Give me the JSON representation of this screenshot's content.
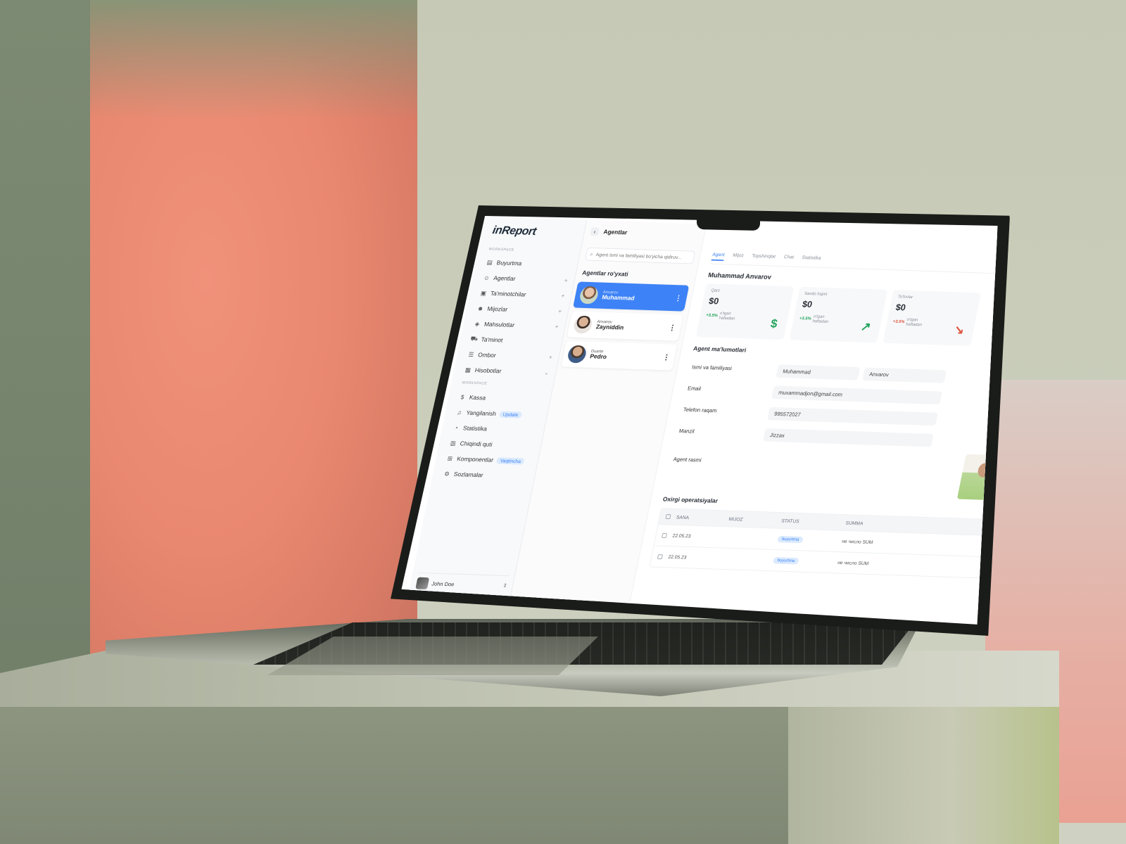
{
  "brand": {
    "logo": "inReport",
    "accent": "#3d82f6"
  },
  "sidebar": {
    "section_labels": [
      "WORKSPACE",
      "WORKSPACE"
    ],
    "items": [
      {
        "label": "Buyurtma",
        "icon": "clipboard-icon",
        "plus": false
      },
      {
        "label": "Agentlar",
        "icon": "users-icon",
        "plus": true
      },
      {
        "label": "Ta'minotchilar",
        "icon": "supplier-icon",
        "plus": true
      },
      {
        "label": "Mijozlar",
        "icon": "user-plus-icon",
        "plus": true
      },
      {
        "label": "Mahsulotlar",
        "icon": "box-icon",
        "plus": true
      },
      {
        "label": "Ta'minot",
        "icon": "truck-icon",
        "plus": false
      },
      {
        "label": "Ombor",
        "icon": "database-icon",
        "plus": true
      },
      {
        "label": "Hisobotlar",
        "icon": "report-icon",
        "chevron": true
      },
      {
        "label": "Kassa",
        "icon": "dollar-icon"
      },
      {
        "label": "Yangilanish",
        "icon": "bell-icon",
        "badge": "Update"
      },
      {
        "label": "Statistika",
        "icon": "pie-chart-icon"
      },
      {
        "label": "Chiqindi quti",
        "icon": "trash-icon"
      },
      {
        "label": "Komponentlar",
        "icon": "grid-icon",
        "badge": "Vaqtincha"
      },
      {
        "label": "Sozlamalar",
        "icon": "gear-icon"
      }
    ],
    "user": {
      "name": "John Doe"
    }
  },
  "list": {
    "back_title": "Agentlar",
    "search_placeholder": "Agent ismi va familiyasi bo'yicha qidiruv...",
    "title": "Agentlar ro'yxati",
    "agents": [
      {
        "surname": "Anvarov",
        "name": "Muhammad",
        "active": true
      },
      {
        "surname": "Anvarov",
        "name": "Zayniddin",
        "active": false
      },
      {
        "surname": "Duarte",
        "name": "Pedro",
        "active": false
      }
    ]
  },
  "main": {
    "tabs": [
      "Agent",
      "Mijoz",
      "Topshiriqlar",
      "Chat",
      "Statistika"
    ],
    "active_tab": "Agent",
    "person_name": "Muhammad Anvarov",
    "stats": [
      {
        "label": "Qarz",
        "value": "$0",
        "pct": "+3.5%",
        "note": "o'tgan haftadan",
        "trend": "up",
        "icon": "$"
      },
      {
        "label": "Savdo hajmi",
        "value": "$0",
        "pct": "+3.5%",
        "note": "o'tgan haftadan",
        "trend": "up",
        "icon": "↗"
      },
      {
        "label": "To'lovlar",
        "value": "$0",
        "pct": "+3.5%",
        "note": "o'tgan haftadan",
        "trend": "down",
        "icon": "↘"
      }
    ],
    "info_title": "Agent ma'lumotlari",
    "fields": {
      "name_label": "Ismi va familiyasi",
      "first_name": "Muhammad",
      "last_name": "Anvarov",
      "email_label": "Email",
      "email": "muxammadjon@gmail.com",
      "phone_label": "Telefon raqam",
      "phone": "995572027",
      "address_label": "Manzil",
      "address": "Jizzax",
      "photo_label": "Agent rasmi"
    },
    "ops_title": "Oxirgi operatsiyalar",
    "ops_columns": [
      "SANA",
      "MIJOZ",
      "STATUS",
      "SUMMA"
    ],
    "ops_rows": [
      {
        "date": "22.05.23",
        "client": "",
        "status": "buyurtma",
        "sum": "не число SUM"
      },
      {
        "date": "22.05.23",
        "client": "",
        "status": "buyurtma",
        "sum": "не число SUM"
      }
    ]
  }
}
